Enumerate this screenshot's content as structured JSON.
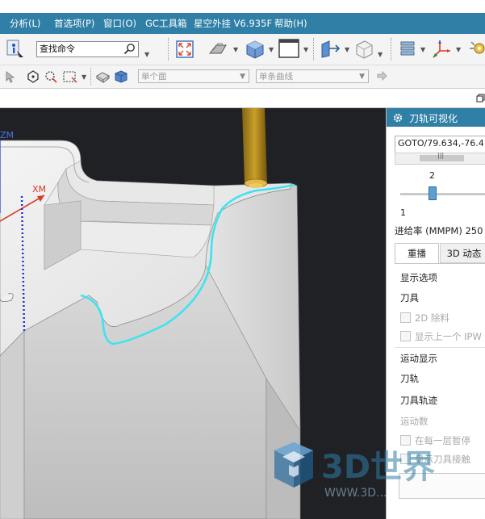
{
  "menubar": {
    "items": [
      "分析(L)",
      "首选项(P)",
      "窗口(O)",
      "GC工具箱",
      "星空外挂 V6.935F",
      "帮助(H)"
    ]
  },
  "toolbar": {
    "search_value": "查找命令"
  },
  "selection_bar": {
    "filter_value": "单个面",
    "curve_rule_value": "单条曲线"
  },
  "viewport": {
    "axis_xm": "XM",
    "axis_zm": "ZM"
  },
  "panel": {
    "title": "刀轨可视化",
    "goto_value": "GOTO/79.634,-76.4",
    "slider_value": "2",
    "slider_min": "1",
    "feed_label": "进给率 (MMPM) 250",
    "tabs": [
      "重播",
      "3D 动态"
    ],
    "section_display_options": "显示选项",
    "tool_label": "刀具",
    "opt_2d_remove": "2D 除料",
    "opt_show_prev_ipw": "显示上一个 IPW",
    "section_motion_display": "运动显示",
    "toolpath_label": "刀轨",
    "tool_trace_label": "刀具轨迹",
    "section_motion_count": "运动数",
    "opt_pause_each_layer": "在每一层暂停",
    "opt_show_tool_contact": "显示刀具接触"
  },
  "watermark": {
    "text": "3D世界",
    "url": "WWW.3D..."
  },
  "colors": {
    "accent": "#2f7fa6",
    "viewport_bg": "#1f2125",
    "toolpath": "#3fe3f0",
    "tool": "#c89a1a",
    "csys_x": "#d83a2a",
    "csys_z": "#2a56d8"
  }
}
